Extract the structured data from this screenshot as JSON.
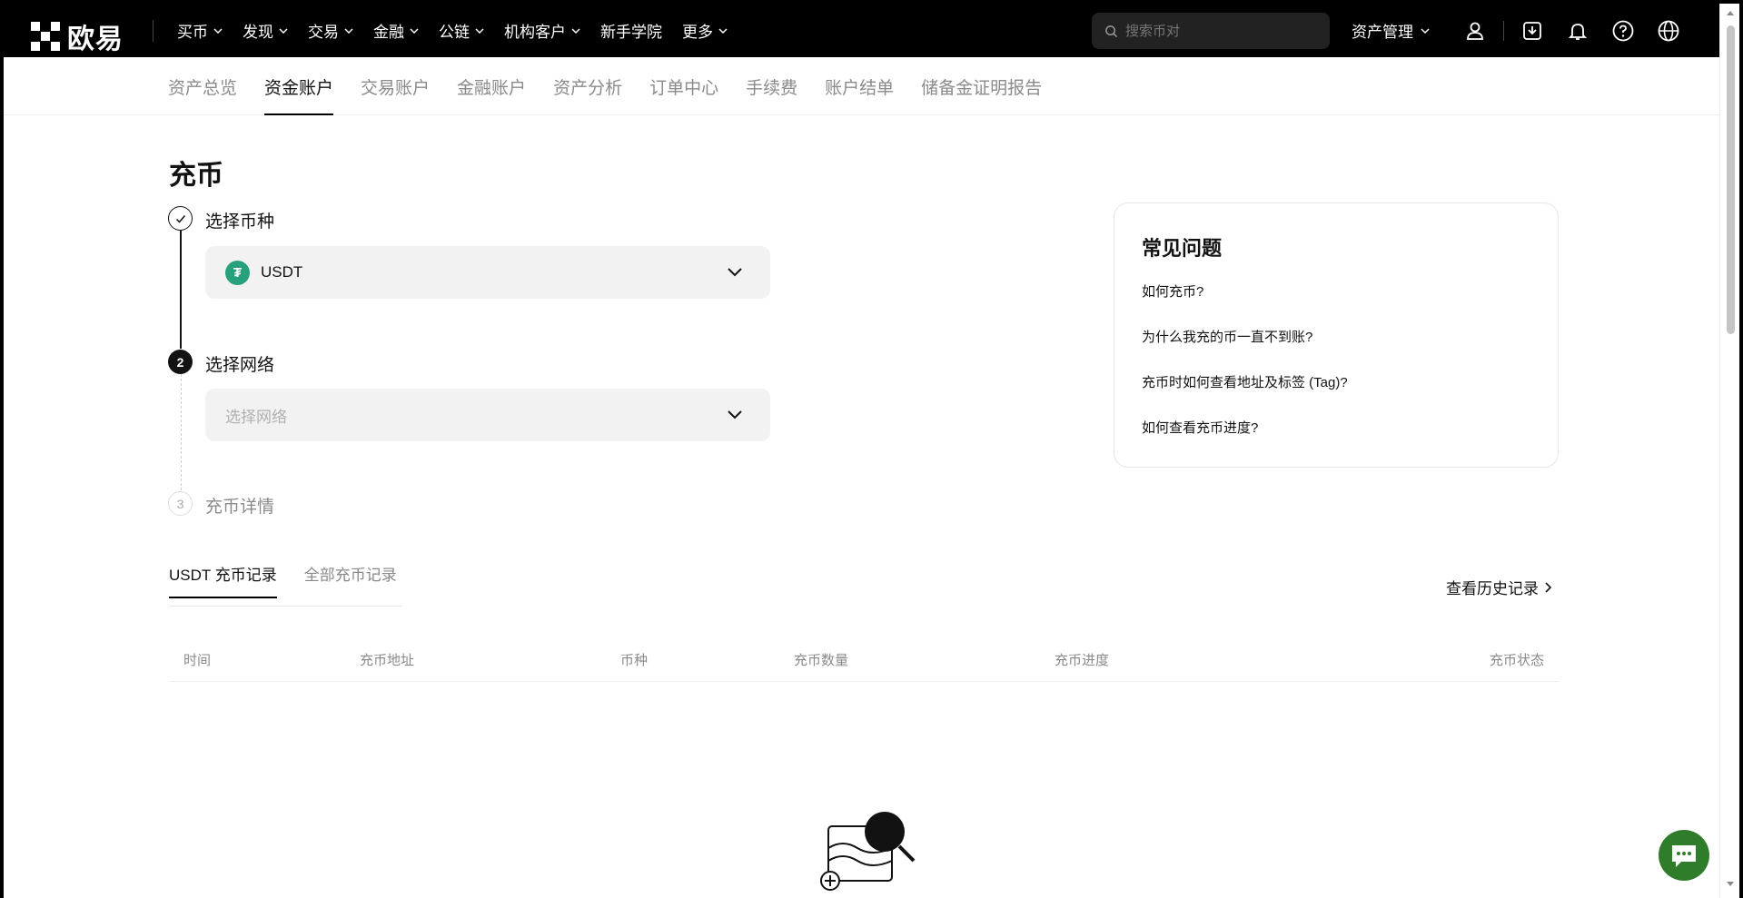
{
  "brand": {
    "name": "欧易"
  },
  "nav": {
    "items": [
      {
        "label": "买币",
        "dropdown": true
      },
      {
        "label": "发现",
        "dropdown": true
      },
      {
        "label": "交易",
        "dropdown": true
      },
      {
        "label": "金融",
        "dropdown": true
      },
      {
        "label": "公链",
        "dropdown": true
      },
      {
        "label": "机构客户",
        "dropdown": true
      },
      {
        "label": "新手学院",
        "dropdown": false
      },
      {
        "label": "更多",
        "dropdown": true
      }
    ],
    "search_placeholder": "搜索币对",
    "asset_management": "资产管理"
  },
  "subnav": {
    "items": [
      "资产总览",
      "资金账户",
      "交易账户",
      "金融账户",
      "资产分析",
      "订单中心",
      "手续费",
      "账户结单",
      "储备金证明报告"
    ],
    "active_index": 1
  },
  "deposit": {
    "title": "充币",
    "steps": [
      {
        "number": "1",
        "label": "选择币种",
        "state": "done"
      },
      {
        "number": "2",
        "label": "选择网络",
        "state": "active"
      },
      {
        "number": "3",
        "label": "充币详情",
        "state": "pending"
      }
    ],
    "coin": {
      "icon_letter": "₮",
      "value": "USDT"
    },
    "network_placeholder": "选择网络"
  },
  "faq": {
    "title": "常见问题",
    "links": [
      "如何充币?",
      "为什么我充的币一直不到账?",
      "充币时如何查看地址及标签 (Tag)?",
      "如何查看充币进度?"
    ]
  },
  "records": {
    "tabs": [
      "USDT 充币记录",
      "全部充币记录"
    ],
    "active_tab": 0,
    "history_link": "查看历史记录",
    "columns": [
      "时间",
      "充币地址",
      "币种",
      "充币数量",
      "充币进度",
      "充币状态"
    ]
  },
  "colors": {
    "accent": "#000000",
    "usdt": "#26a17b",
    "chat": "#2f7d2a"
  }
}
